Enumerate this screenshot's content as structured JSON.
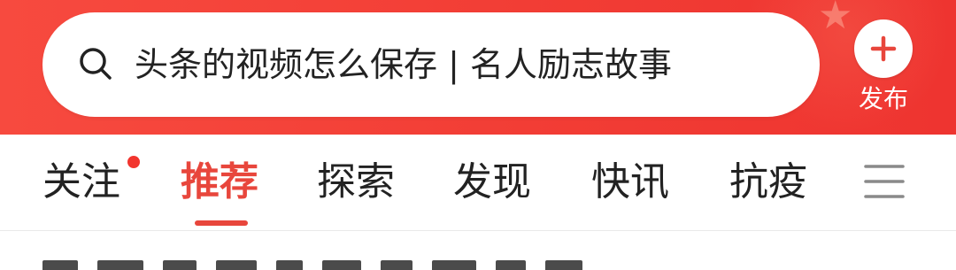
{
  "header": {
    "search": {
      "text": "头条的视频怎么保存 | 名人励志故事",
      "icon": "search-icon"
    },
    "publish": {
      "label": "发布",
      "icon": "plus-icon"
    },
    "colors": {
      "background": "#f23d35",
      "accent": "#e8463c"
    }
  },
  "tabs": {
    "items": [
      {
        "label": "关注",
        "has_dot": true
      },
      {
        "label": "推荐",
        "active": true
      },
      {
        "label": "探索"
      },
      {
        "label": "发现"
      },
      {
        "label": "快讯"
      },
      {
        "label": "抗疫"
      }
    ],
    "menu_icon": "menu-icon"
  }
}
